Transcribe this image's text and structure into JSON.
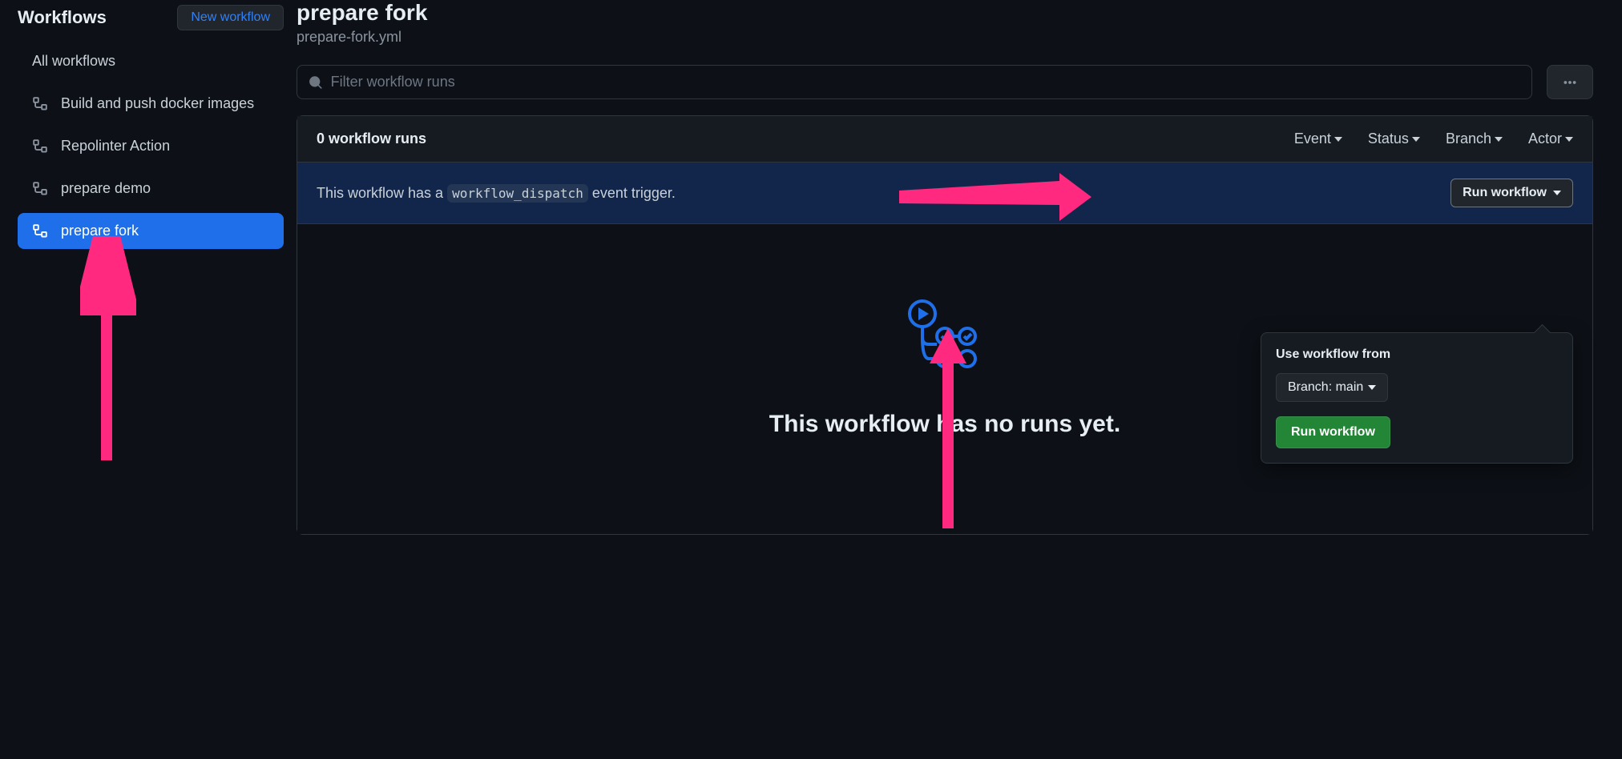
{
  "sidebar": {
    "title": "Workflows",
    "new_button": "New workflow",
    "all_link": "All workflows",
    "items": [
      {
        "label": "Build and push docker images"
      },
      {
        "label": "Repolinter Action"
      },
      {
        "label": "prepare demo"
      },
      {
        "label": "prepare fork"
      }
    ]
  },
  "page": {
    "title": "prepare fork",
    "subtitle": "prepare-fork.yml"
  },
  "search": {
    "placeholder": "Filter workflow runs"
  },
  "runs": {
    "count_label": "0 workflow runs",
    "filters": [
      "Event",
      "Status",
      "Branch",
      "Actor"
    ]
  },
  "dispatch": {
    "prefix": "This workflow has a ",
    "code": "workflow_dispatch",
    "suffix": " event trigger.",
    "button": "Run workflow"
  },
  "popover": {
    "heading": "Use workflow from",
    "branch_label": "Branch: main",
    "run_button": "Run workflow"
  },
  "empty": {
    "title": "This workflow has no runs yet."
  }
}
